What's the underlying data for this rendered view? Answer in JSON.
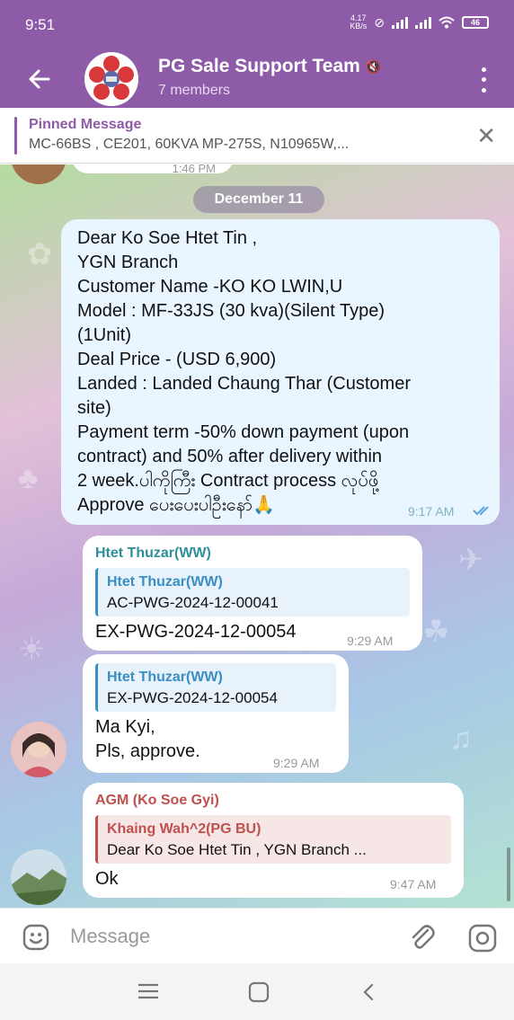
{
  "status_bar": {
    "time": "9:51",
    "net_speed_top": "4.17",
    "net_speed_bottom": "KB/s",
    "battery": "46"
  },
  "header": {
    "title": "PG Sale Support Team",
    "subtitle": "7 members",
    "color": "#8e5ba8"
  },
  "pinned": {
    "title": "Pinned Message",
    "text": "MC-66BS , CE201, 60KVA  MP-275S, N10965W,..."
  },
  "chat": {
    "date_chip": "December 11",
    "messages": [
      {
        "type": "outgoing",
        "lines": [
          "Dear Ko Soe Htet Tin ,",
          "YGN Branch",
          "Customer Name -KO KO LWIN,U",
          "Model : MF-33JS (30 kva)(Silent Type)",
          "(1Unit)",
          "Deal Price - (USD 6,900)",
          "Landed : Landed Chaung Thar (Customer",
          "site)",
          "Payment term -50% down payment (upon",
          "contract) and 50% after delivery within",
          "2 week.ပါကိုကြီး Contract process လုပ်ဖို့",
          "Approve ပေးပေးပါဦးနော်🙏"
        ],
        "time": "9:17 AM",
        "status_icon": "double-check-icon"
      },
      {
        "type": "incoming",
        "sender": "Htet Thuzar(WW)",
        "reply_name": "Htet Thuzar(WW)",
        "reply_text": "AC-PWG-2024-12-00041",
        "text": "EX-PWG-2024-12-00054",
        "time": "9:29 AM"
      },
      {
        "type": "incoming",
        "reply_name": "Htet Thuzar(WW)",
        "reply_text": "EX-PWG-2024-12-00054",
        "lines": [
          "Ma Kyi,",
          "Pls, approve."
        ],
        "time": "9:29 AM"
      },
      {
        "type": "incoming",
        "sender": "AGM (Ko Soe Gyi)",
        "reply_name": "Khaing Wah^2(PG BU)",
        "reply_text": "Dear Ko Soe Htet Tin , YGN Branch  ...",
        "text": "Ok",
        "time": "9:47 AM"
      }
    ],
    "top_partial_time": "1:46 PM"
  },
  "input": {
    "placeholder": "Message"
  },
  "colors": {
    "accent": "#8e5ba8",
    "reply_blue": "#3b8ec4",
    "reply_red": "#c0504d",
    "sender_teal": "#2e8f9a",
    "sender_red": "#c0504d"
  }
}
